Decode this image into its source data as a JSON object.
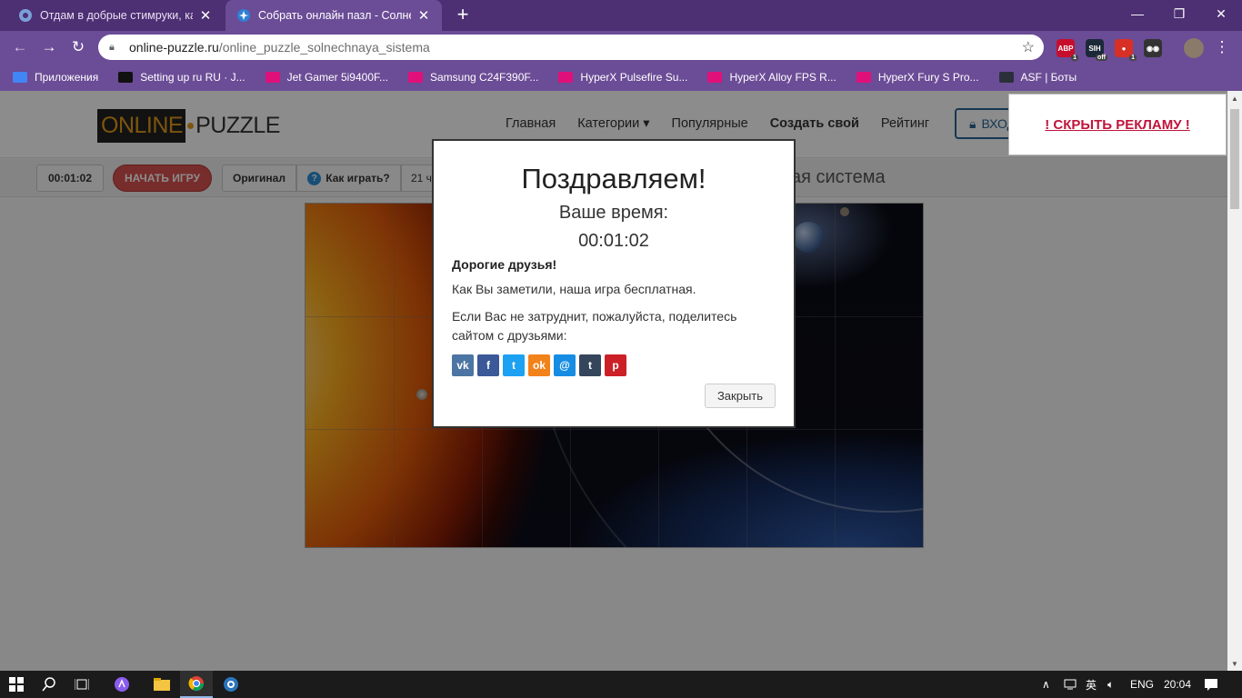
{
  "browser": {
    "tabs": [
      {
        "title": "Отдам в добрые стимруки, карт",
        "close": "✕"
      },
      {
        "title": "Собрать онлайн пазл - Солнечн",
        "close": "✕"
      }
    ],
    "new_tab": "+",
    "window_controls": {
      "minimize": "—",
      "restore": "❐",
      "close": "✕"
    },
    "url_host": "online-puzzle.ru",
    "url_path": "/online_puzzle_solnechnaya_sistema",
    "extensions": [
      {
        "name": "abp-icon",
        "label": "ABP",
        "badge": "1",
        "color": "#c70d2c"
      },
      {
        "name": "steam-icon",
        "label": "SIH",
        "badge": "off",
        "color": "#1b2838"
      },
      {
        "name": "red-shield-icon",
        "label": "●",
        "badge": "1",
        "color": "#d93025"
      },
      {
        "name": "glasses-icon",
        "label": "◉◉",
        "badge": "",
        "color": "#333333"
      }
    ],
    "bookmarks": [
      {
        "label": "Приложения",
        "icon": "apps-grid-icon",
        "color": "#4285f4"
      },
      {
        "label": "Setting up ru RU · J...",
        "icon": "github-icon",
        "color": "#111111"
      },
      {
        "label": "Jet Gamer 5i9400F...",
        "icon": "store-icon",
        "color": "#e0107a"
      },
      {
        "label": "Samsung C24F390F...",
        "icon": "store-icon",
        "color": "#e0107a"
      },
      {
        "label": "HyperX Pulsefire Su...",
        "icon": "store-icon",
        "color": "#e0107a"
      },
      {
        "label": "HyperX Alloy FPS R...",
        "icon": "store-icon",
        "color": "#e0107a"
      },
      {
        "label": "HyperX Fury S Pro...",
        "icon": "store-icon",
        "color": "#e0107a"
      },
      {
        "label": "ASF | Боты",
        "icon": "asf-icon",
        "color": "#2b2f3a"
      }
    ]
  },
  "site": {
    "logo_online": "ONLINE",
    "logo_puzzle": "PUZZLE",
    "menu": [
      "Главная",
      "Категории ▾",
      "Популярные",
      "Создать свой",
      "Рейтинг"
    ],
    "login": "ВХОД",
    "hide_ad": "! СКРЫТЬ РЕКЛАМУ !"
  },
  "game": {
    "timer": "00:01:02",
    "start": "НАЧАТЬ ИГРУ",
    "original": "Оригинал",
    "howto": "Как играть?",
    "pieces": "21 ч",
    "title_visible": "ая система"
  },
  "modal": {
    "title": "Поздравляем!",
    "your_time_label": "Ваше время:",
    "time": "00:01:02",
    "greeting": "Дорогие друзья!",
    "line1": "Как Вы заметили, наша игра бесплатная.",
    "line2": "Если Вас не затруднит, пожалуйста, поделитесь сайтом с друзьями:",
    "shares": [
      {
        "name": "vk-share-icon",
        "glyph": "vk",
        "color": "#4c75a3"
      },
      {
        "name": "facebook-share-icon",
        "glyph": "f",
        "color": "#3b5998"
      },
      {
        "name": "twitter-share-icon",
        "glyph": "t",
        "color": "#1da1f2"
      },
      {
        "name": "odnoklassniki-share-icon",
        "glyph": "ok",
        "color": "#f2821a"
      },
      {
        "name": "moimir-share-icon",
        "glyph": "@",
        "color": "#168de2"
      },
      {
        "name": "tumblr-share-icon",
        "glyph": "t",
        "color": "#35465c"
      },
      {
        "name": "pinterest-share-icon",
        "glyph": "p",
        "color": "#cb2027"
      }
    ],
    "close": "Закрыть"
  },
  "taskbar": {
    "lang": "ENG",
    "time": "20:04"
  }
}
